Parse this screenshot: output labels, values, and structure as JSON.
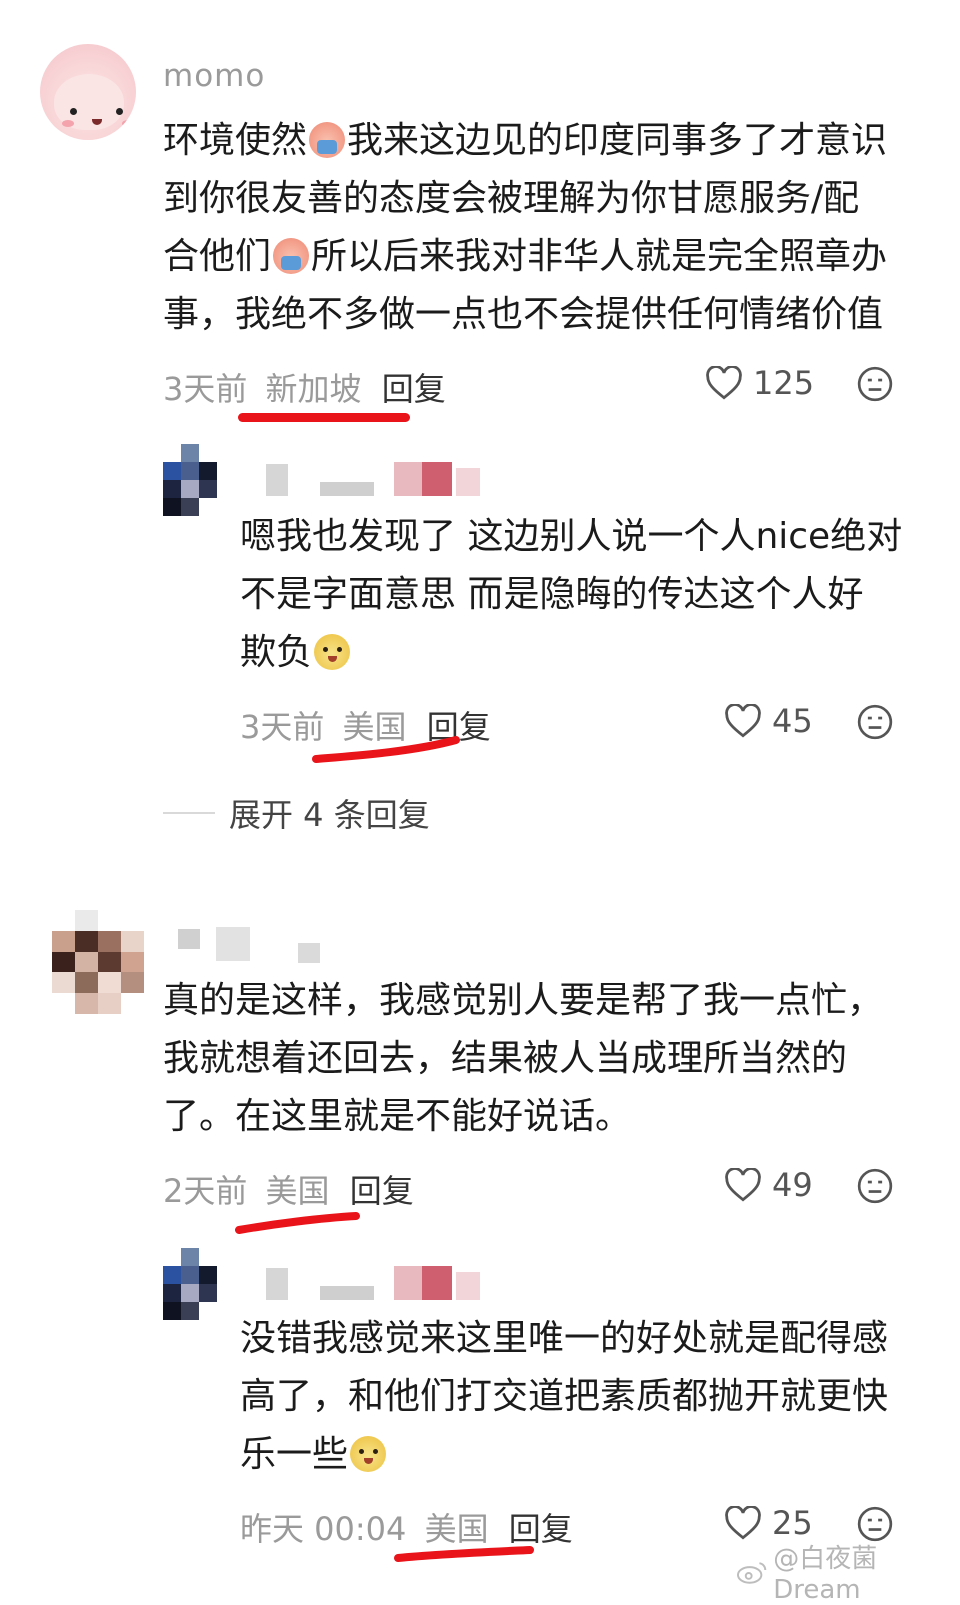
{
  "comments": [
    {
      "username": "momo",
      "text_parts": [
        "环境使然",
        "我来这边见的印度同事多了才意识",
        "到你很友善的态度会被理解为你甘愿服务/配",
        "合他们",
        "所以后来我对非华人就是完全照章办",
        "事，我绝不多做一点也不会提供任何情绪价值"
      ],
      "time": "3天前",
      "location": "新加坡",
      "reply_label": "回复",
      "likes": "125",
      "emoji": "crying-face"
    },
    {
      "username": "",
      "text_lines": [
        "嗯我也发现了 这边别人说一个人nice绝对",
        "不是字面意思 而是隐晦的传达这个人好",
        "欺负"
      ],
      "time": "3天前",
      "location": "美国",
      "reply_label": "回复",
      "likes": "45",
      "emoji": "dog-face"
    },
    {
      "username": "",
      "text_lines": [
        "真的是这样，我感觉别人要是帮了我一点忙，",
        "我就想着还回去，结果被人当成理所当然的",
        "了。在这里就是不能好说话。"
      ],
      "time": "2天前",
      "location": "美国",
      "reply_label": "回复",
      "likes": "49"
    },
    {
      "username": "",
      "text_lines": [
        "没错我感觉来这里唯一的好处就是配得感",
        "高了，和他们打交道把素质都抛开就更快",
        "乐一些"
      ],
      "time": "昨天 00:04",
      "location": "美国",
      "reply_label": "回复",
      "likes": "25",
      "emoji": "dog-face"
    }
  ],
  "expand_replies": "展开 4 条回复",
  "watermark": "@白夜菌Dream",
  "colors": {
    "annotation_line": "#e8141a",
    "meta_text": "#9a9a9a"
  },
  "icons": [
    "heart-outline-icon",
    "dislike-face-icon",
    "weibo-logo-icon"
  ]
}
